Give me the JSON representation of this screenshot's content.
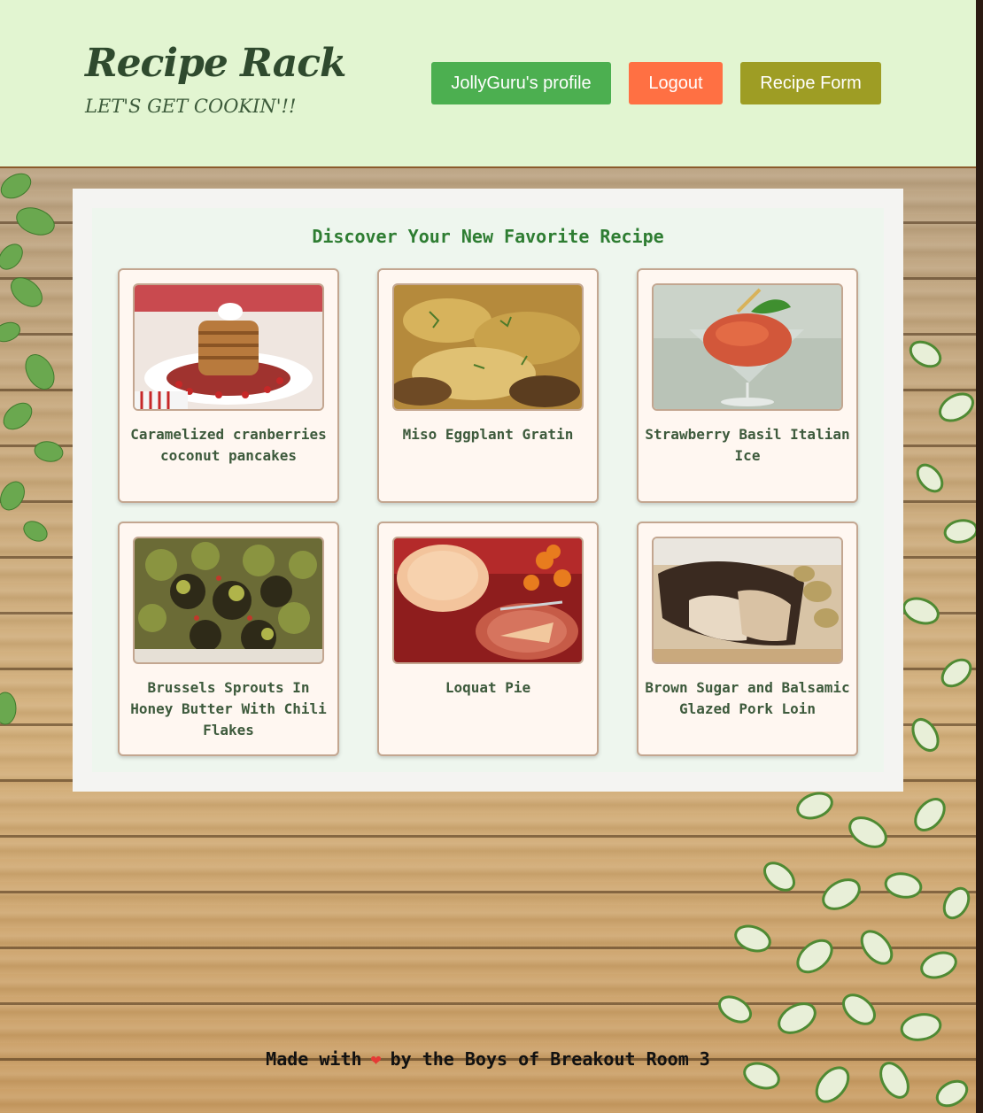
{
  "header": {
    "logo": "Recipe Rack",
    "tagline": "LET'S GET COOKIN'!!",
    "nav": {
      "profile_label": "JollyGuru's profile",
      "logout_label": "Logout",
      "form_label": "Recipe Form"
    },
    "colors": {
      "background": "#e2f5d1",
      "profile": "#4caf50",
      "logout": "#ff7043",
      "form": "#9e9d24"
    }
  },
  "main": {
    "title": "Discover Your New Favorite Recipe",
    "recipes": [
      {
        "name": "Caramelized cranberries coconut pancakes",
        "image": "pancakes-photo"
      },
      {
        "name": "Miso Eggplant Gratin",
        "image": "gratin-photo"
      },
      {
        "name": "Strawberry Basil Italian Ice",
        "image": "italian-ice-photo"
      },
      {
        "name": "Brussels Sprouts In Honey Butter With Chili Flakes",
        "image": "brussels-sprouts-photo"
      },
      {
        "name": "Loquat Pie",
        "image": "pie-photo"
      },
      {
        "name": "Brown Sugar and Balsamic Glazed Pork Loin",
        "image": "pork-loin-photo"
      }
    ]
  },
  "footer": {
    "before": "Made with",
    "icon": "heart-icon",
    "after": "by the Boys of Breakout Room 3"
  }
}
